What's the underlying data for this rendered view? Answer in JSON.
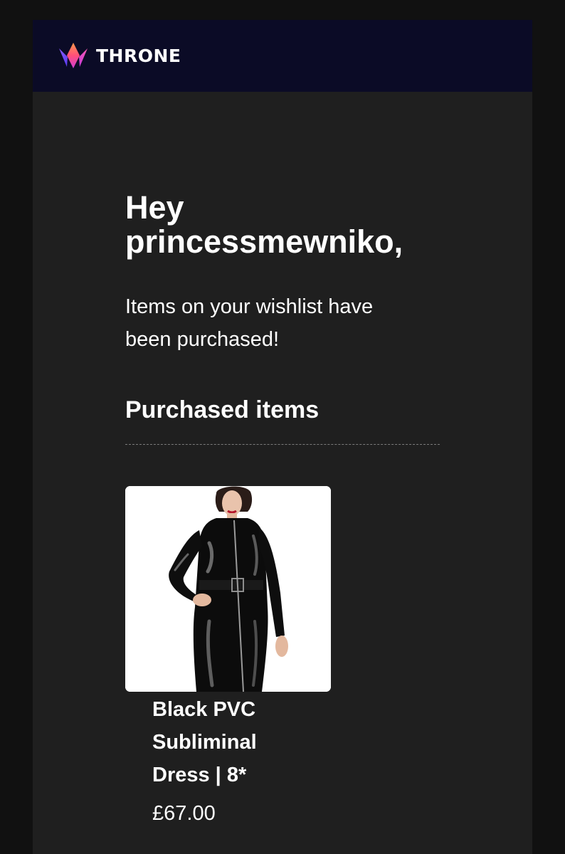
{
  "header": {
    "brand_name": "THRONE",
    "logo_icon": "crown-logo-icon",
    "background_color": "#0b0b26"
  },
  "email": {
    "greeting": "Hey princessmewniko,",
    "message": "Items on your wishlist have been purchased!",
    "section_title": "Purchased items",
    "background_color": "#1f1f1f"
  },
  "purchased_items": [
    {
      "image_icon": "product-photo-black-pvc-dress",
      "name": "Black PVC Subliminal Dress | 8*",
      "price": "£67.00"
    }
  ]
}
